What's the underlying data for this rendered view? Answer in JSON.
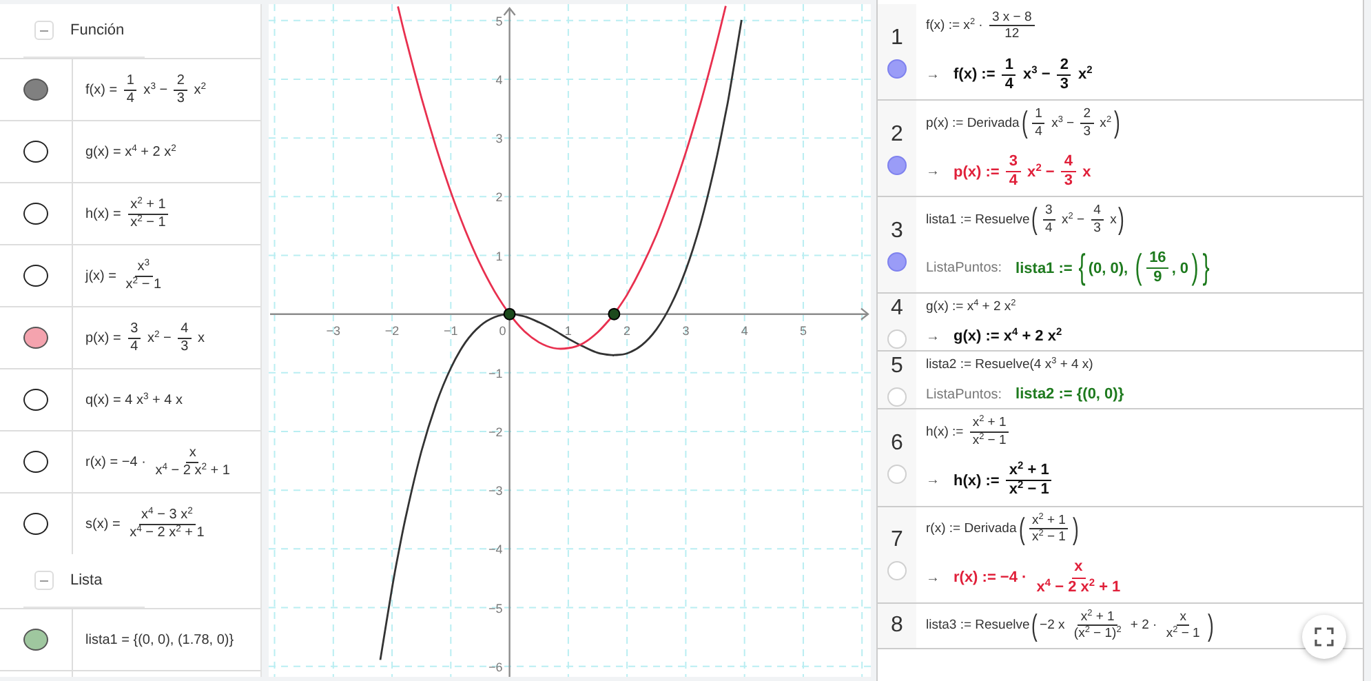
{
  "algebra": {
    "groups": [
      {
        "title": "Función",
        "expanded": true,
        "items": [
          {
            "shown": true,
            "color": "#808080",
            "parts": [
              {
                "t": "f(x) = "
              },
              {
                "frac": [
                  "1",
                  "4"
                ]
              },
              {
                "t": " x$^{3}$ − "
              },
              {
                "frac": [
                  "2",
                  "3"
                ]
              },
              {
                "t": " x$^{2}$"
              }
            ]
          },
          {
            "shown": false,
            "parts": [
              {
                "t": "g(x) = x$^{4}$ + 2 x$^{2}$"
              }
            ]
          },
          {
            "shown": false,
            "parts": [
              {
                "t": "h(x) = "
              },
              {
                "frac": [
                  "x$^{2}$ + 1",
                  "x$^{2}$ − 1"
                ]
              }
            ]
          },
          {
            "shown": false,
            "parts": [
              {
                "t": "j(x) = "
              },
              {
                "frac": [
                  "x$^{3}$",
                  "x$^{2}$ − 1"
                ]
              }
            ]
          },
          {
            "shown": true,
            "color": "#f4a3ae",
            "parts": [
              {
                "t": "p(x) = "
              },
              {
                "frac": [
                  "3",
                  "4"
                ]
              },
              {
                "t": " x$^{2}$ − "
              },
              {
                "frac": [
                  "4",
                  "3"
                ]
              },
              {
                "t": " x"
              }
            ]
          },
          {
            "shown": false,
            "parts": [
              {
                "t": "q(x) = 4 x$^{3}$ + 4 x"
              }
            ]
          },
          {
            "shown": false,
            "parts": [
              {
                "t": "r(x) = −4 · "
              },
              {
                "frac": [
                  "x",
                  "x$^{4}$ − 2 x$^{2}$ + 1"
                ]
              }
            ]
          },
          {
            "shown": false,
            "parts": [
              {
                "t": "s(x) = "
              },
              {
                "frac": [
                  "x$^{4}$ − 3 x$^{2}$",
                  "x$^{4}$ − 2 x$^{2}$ + 1"
                ]
              }
            ]
          }
        ]
      },
      {
        "title": "Lista",
        "expanded": true,
        "items": [
          {
            "shown": true,
            "color": "#9fc79f",
            "parts": [
              {
                "t": "lista1 = {(0, 0), (1.78, 0)}"
              }
            ]
          }
        ]
      }
    ]
  },
  "graph": {
    "chart_data": {
      "type": "line",
      "xlim": [
        -4.1,
        6.15
      ],
      "ylim": [
        -6.18,
        5.28
      ],
      "xticks": [
        {
          "value": -3,
          "label": "−3"
        },
        {
          "value": -2,
          "label": "−2"
        },
        {
          "value": -1,
          "label": "−1"
        },
        0,
        1,
        2,
        3,
        4,
        5
      ],
      "yticks": [
        {
          "value": -6,
          "label": "−6"
        },
        {
          "value": -5,
          "label": "−5"
        },
        {
          "value": -4,
          "label": "−4"
        },
        {
          "value": -3,
          "label": "−3"
        },
        {
          "value": -2,
          "label": "−2"
        },
        {
          "value": -1,
          "label": "−1"
        },
        1,
        2,
        3,
        4,
        5
      ],
      "x": [
        -2.2,
        -2,
        -1.9,
        -1.75,
        -1.5,
        -1.25,
        -1,
        -0.75,
        -0.5,
        -0.25,
        0,
        0.25,
        0.5,
        0.75,
        1,
        1.25,
        1.5,
        1.75,
        1.78,
        2,
        2.25,
        2.5,
        2.75,
        3,
        3.25,
        3.5,
        3.68,
        3.75,
        3.95
      ],
      "series": [
        {
          "color": "#333333",
          "values": [
            -5.89,
            -4.67,
            -4.12,
            -3.38,
            -2.34,
            -1.53,
            -0.92,
            -0.48,
            -0.2,
            -0.05,
            0,
            -0.04,
            -0.14,
            -0.27,
            -0.42,
            -0.55,
            -0.66,
            -0.7,
            -0.7,
            -0.67,
            -0.53,
            -0.26,
            0.16,
            0.75,
            1.54,
            2.55,
            3.43,
            3.81,
            5.01
          ]
        },
        {
          "color": "#e8304f",
          "values": [
            null,
            null,
            5.24,
            4.63,
            3.69,
            2.84,
            2.08,
            1.42,
            0.85,
            0.38,
            0,
            -0.29,
            -0.48,
            -0.58,
            -0.58,
            -0.5,
            -0.31,
            -0.04,
            0,
            0.33,
            0.8,
            1.35,
            2.01,
            2.75,
            3.59,
            4.52,
            5.25,
            null,
            null
          ]
        }
      ],
      "grid": true
    }
  },
  "cas": {
    "rows": [
      {
        "number": "1",
        "shown": true,
        "input": [
          {
            "t": "f(x) := x$^{2}$ · "
          },
          {
            "frac": [
              "3 x − 8",
              "12"
            ]
          }
        ],
        "output": {
          "prefix": "→",
          "color": "#111111",
          "parts": [
            {
              "t": "f(x) := "
            },
            {
              "frac": [
                "1",
                "4"
              ]
            },
            {
              "t": " x$^{3}$ − "
            },
            {
              "frac": [
                "2",
                "3"
              ]
            },
            {
              "t": " x$^{2}$"
            }
          ]
        }
      },
      {
        "number": "2",
        "shown": true,
        "input": [
          {
            "t": "p(x) := Derivada"
          },
          {
            "open": "(",
            "close": ")",
            "inner": [
              {
                "frac": [
                  "1",
                  "4"
                ]
              },
              {
                "t": " x$^{3}$ − "
              },
              {
                "frac": [
                  "2",
                  "3"
                ]
              },
              {
                "t": " x$^{2}$"
              }
            ]
          }
        ],
        "output": {
          "prefix": "→",
          "color": "#e0203a",
          "parts": [
            {
              "t": "p(x) := "
            },
            {
              "frac": [
                "3",
                "4"
              ]
            },
            {
              "t": " x$^{2}$ − "
            },
            {
              "frac": [
                "4",
                "3"
              ]
            },
            {
              "t": " x"
            }
          ]
        }
      },
      {
        "number": "3",
        "shown": true,
        "input": [
          {
            "t": "lista1 := Resuelve"
          },
          {
            "open": "(",
            "close": ")",
            "inner": [
              {
                "frac": [
                  "3",
                  "4"
                ]
              },
              {
                "t": " x$^{2}$ − "
              },
              {
                "frac": [
                  "4",
                  "3"
                ]
              },
              {
                "t": " x"
              }
            ]
          }
        ],
        "output": {
          "prefix": "ListaPuntos:",
          "color": "#1e7a1e",
          "parts": [
            {
              "t": "lista1 := "
            },
            {
              "open": "{",
              "close": "}",
              "inner": [
                {
                  "t": "(0, 0), "
                },
                {
                  "open": "(",
                  "close": ")",
                  "inner": [
                    {
                      "frac": [
                        "16",
                        "9"
                      ]
                    },
                    {
                      "t": ", 0"
                    }
                  ]
                }
              ]
            }
          ]
        }
      },
      {
        "number": "4",
        "shown": false,
        "input": [
          {
            "t": "g(x) := x$^{4}$ + 2 x$^{2}$"
          }
        ],
        "output": {
          "prefix": "→",
          "color": "#111111",
          "parts": [
            {
              "t": "g(x) := x$^{4}$ + 2 x$^{2}$"
            }
          ]
        }
      },
      {
        "number": "5",
        "shown": false,
        "input": [
          {
            "t": "lista2 := Resuelve(4 x$^{3}$ + 4 x)"
          }
        ],
        "output": {
          "prefix": "ListaPuntos:",
          "color": "#1e7a1e",
          "parts": [
            {
              "t": "lista2 := {(0, 0)}"
            }
          ]
        }
      },
      {
        "number": "6",
        "shown": false,
        "input": [
          {
            "t": "h(x) := "
          },
          {
            "frac": [
              "x$^{2}$ + 1",
              "x$^{2}$ − 1"
            ]
          }
        ],
        "output": {
          "prefix": "→",
          "color": "#111111",
          "parts": [
            {
              "t": "h(x) := "
            },
            {
              "frac": [
                "x$^{2}$ + 1",
                "x$^{2}$ − 1"
              ]
            }
          ]
        }
      },
      {
        "number": "7",
        "shown": false,
        "input": [
          {
            "t": "r(x) := Derivada"
          },
          {
            "open": "(",
            "close": ")",
            "inner": [
              {
                "frac": [
                  "x$^{2}$ + 1",
                  "x$^{2}$ − 1"
                ]
              }
            ]
          }
        ],
        "output": {
          "prefix": "→",
          "color": "#e0203a",
          "parts": [
            {
              "t": "r(x) := −4 · "
            },
            {
              "frac": [
                "x",
                "x$^{4}$ − 2 x$^{2}$ + 1"
              ]
            }
          ]
        }
      },
      {
        "number": "8",
        "input": [
          {
            "t": "lista3 := Resuelve"
          },
          {
            "open": "(",
            "close": ")",
            "inner": [
              {
                "t": "−2 x "
              },
              {
                "frac": [
                  "x$^{2}$ + 1",
                  "(x$^{2}$ − 1)$^{2}$"
                ]
              },
              {
                "t": " + 2 · "
              },
              {
                "frac": [
                  "x",
                  "x$^{2}$ − 1"
                ]
              }
            ]
          }
        ]
      }
    ]
  }
}
